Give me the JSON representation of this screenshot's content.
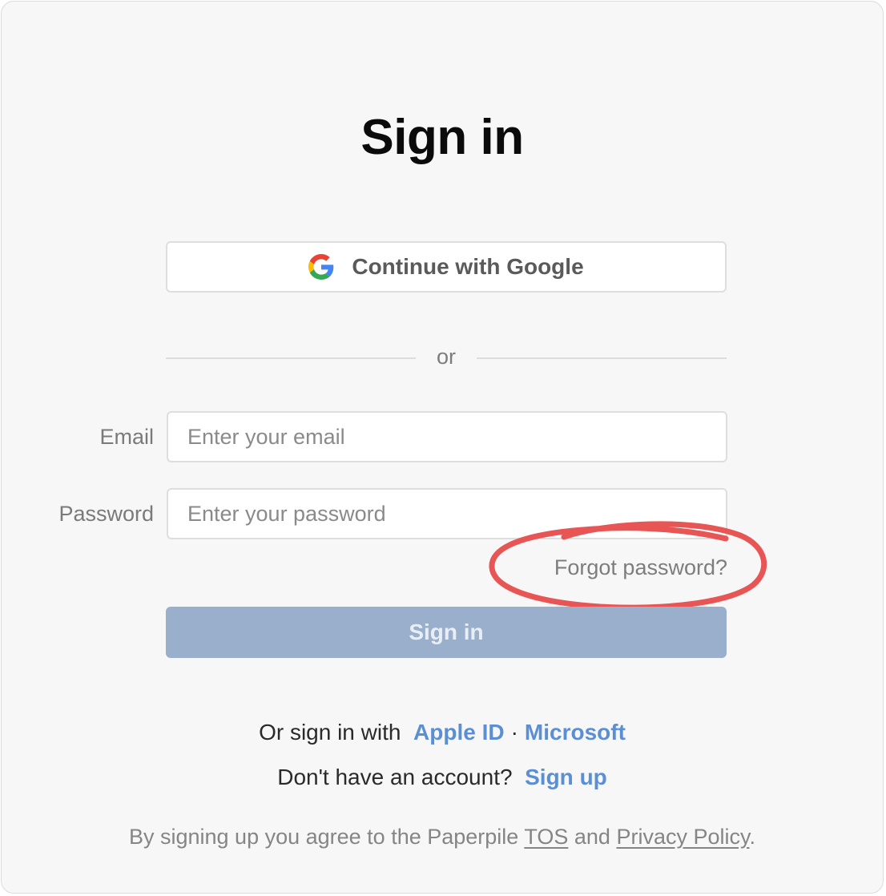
{
  "page": {
    "title": "Sign in"
  },
  "google": {
    "label": "Continue with Google",
    "icon": "google-g-icon"
  },
  "divider": {
    "text": "or"
  },
  "form": {
    "email_label": "Email",
    "email_placeholder": "Enter your email",
    "email_value": "",
    "password_label": "Password",
    "password_placeholder": "Enter your password",
    "password_value": "",
    "forgot_label": "Forgot password?",
    "submit_label": "Sign in"
  },
  "alt_signin": {
    "prefix": "Or sign in with",
    "apple_label": "Apple ID",
    "separator": "·",
    "microsoft_label": "Microsoft"
  },
  "signup": {
    "prompt": "Don't have an account?",
    "link_label": "Sign up"
  },
  "legal": {
    "prefix": "By signing up you agree to the Paperpile",
    "tos_label": "TOS",
    "middle": "and",
    "privacy_label": "Privacy Policy",
    "suffix": "."
  },
  "colors": {
    "accent_link": "#5b8fd4",
    "submit_disabled": "#9aafcb",
    "annotation_red": "#e85555",
    "background": "#f7f7f7"
  }
}
